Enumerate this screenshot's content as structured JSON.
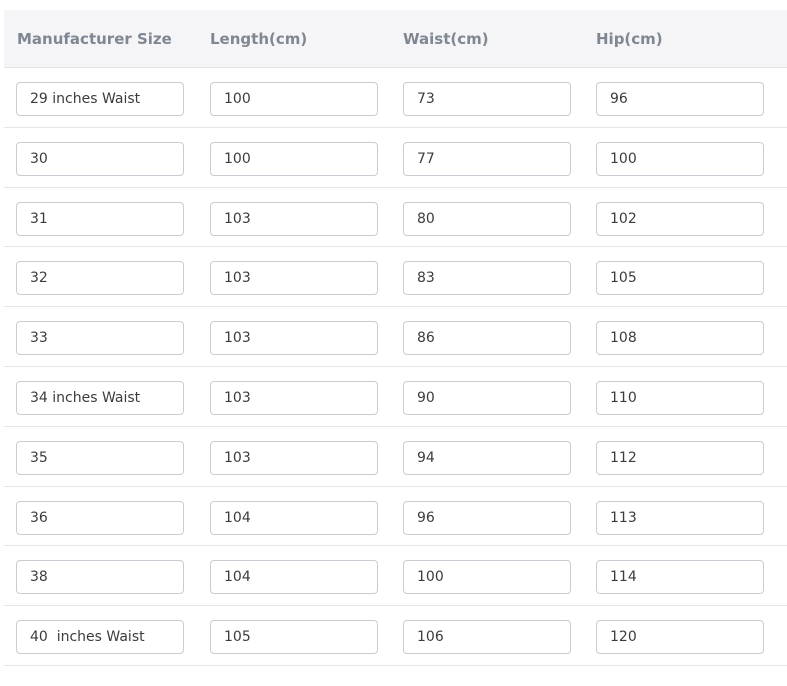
{
  "table": {
    "headers": [
      "Manufacturer Size",
      "Length(cm)",
      "Waist(cm)",
      "Hip(cm)"
    ],
    "rows": [
      [
        "29 inches Waist",
        "100",
        "73",
        "96"
      ],
      [
        "30",
        "100",
        "77",
        "100"
      ],
      [
        "31",
        "103",
        "80",
        "102"
      ],
      [
        "32",
        "103",
        "83",
        "105"
      ],
      [
        "33",
        "103",
        "86",
        "108"
      ],
      [
        "34 inches Waist",
        "103",
        "90",
        "110"
      ],
      [
        "35",
        "103",
        "94",
        "112"
      ],
      [
        "36",
        "104",
        "96",
        "113"
      ],
      [
        "38",
        "104",
        "100",
        "114"
      ],
      [
        "40  inches Waist",
        "105",
        "106",
        "120"
      ]
    ]
  }
}
